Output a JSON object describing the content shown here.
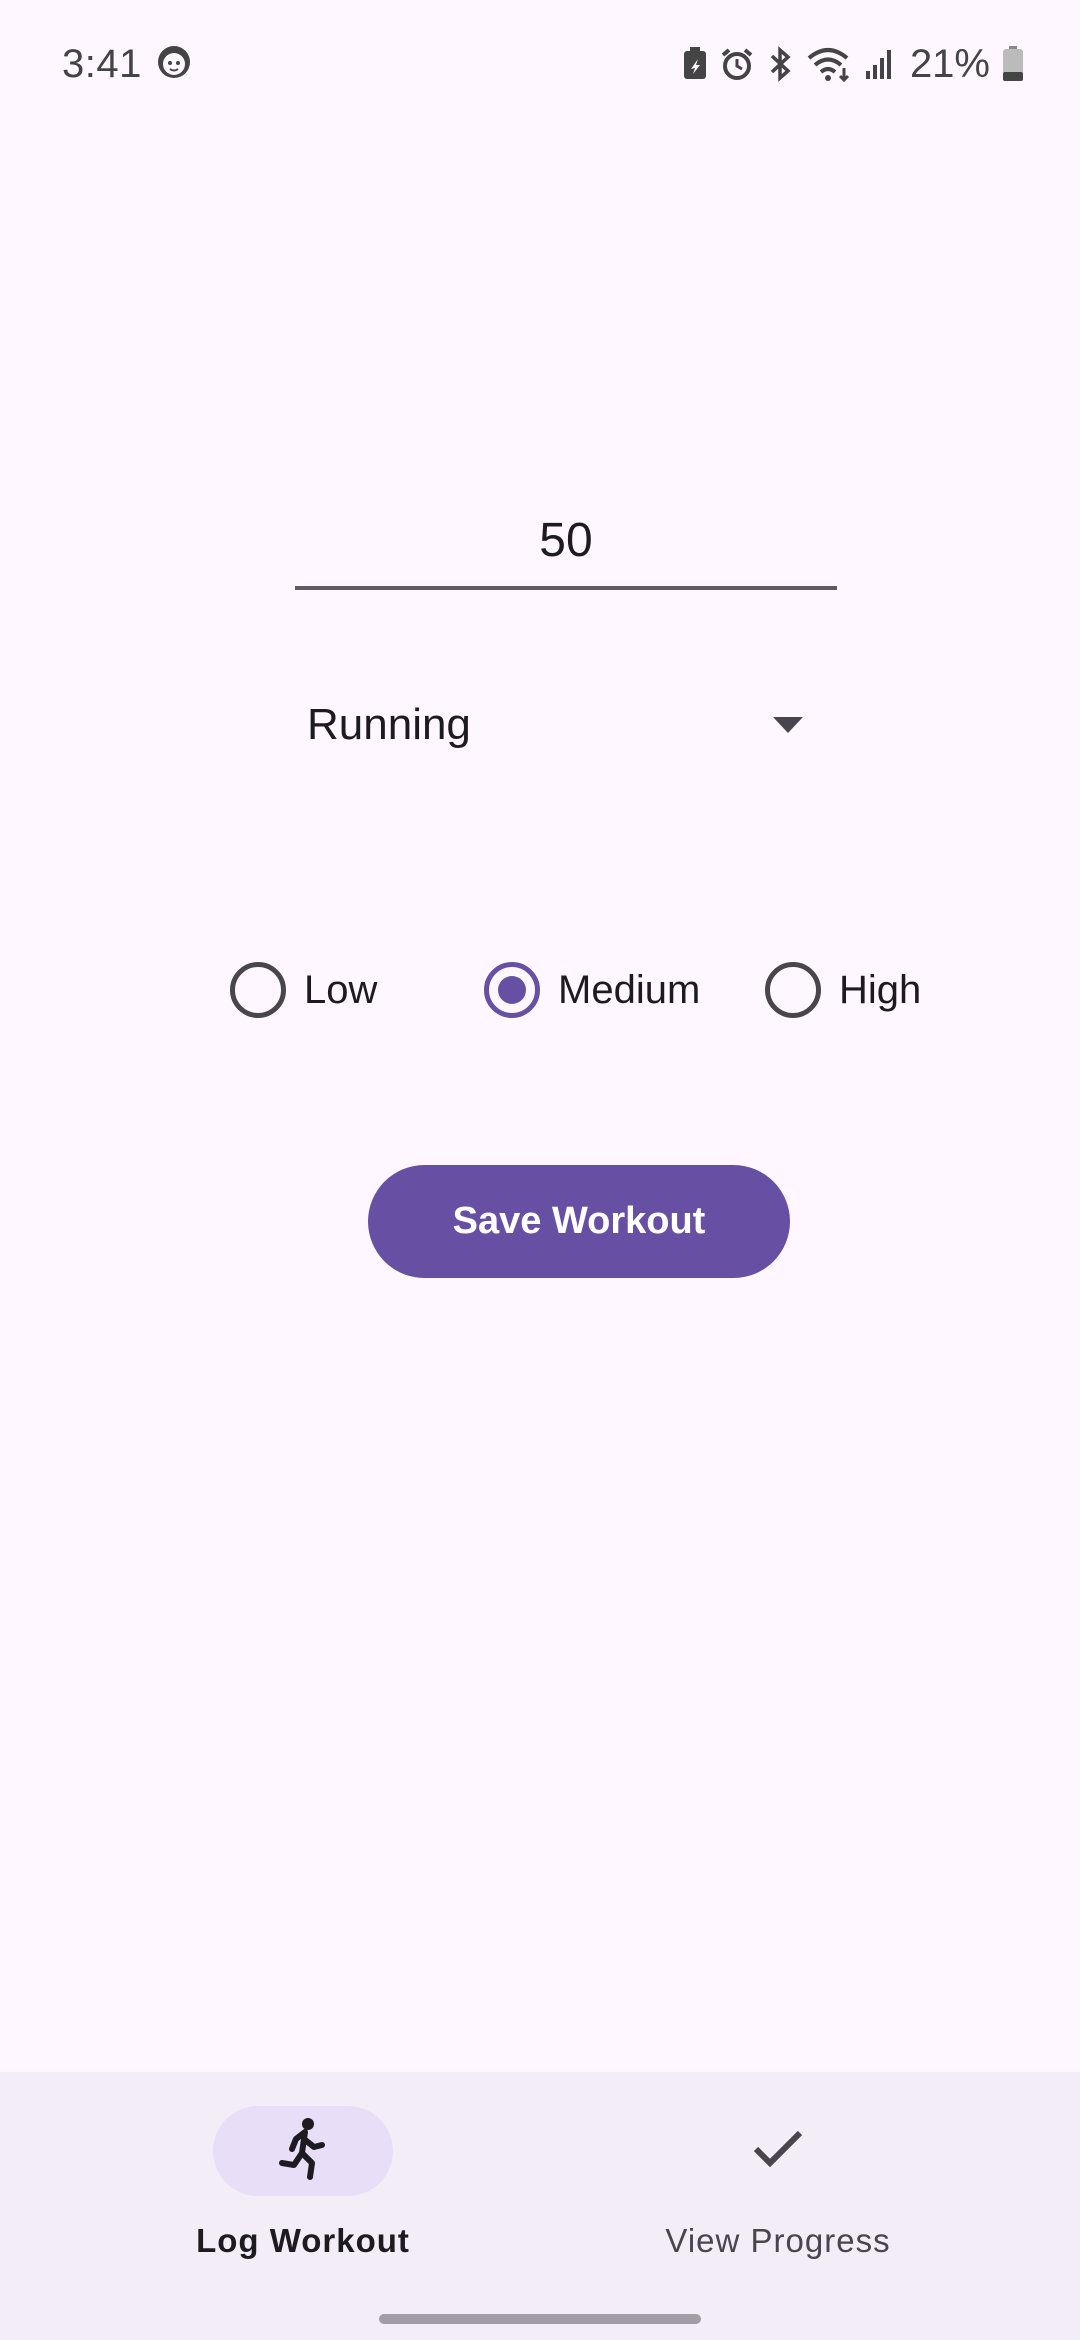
{
  "status_bar": {
    "time": "3:41",
    "battery_percent": "21%",
    "icons": [
      "face-icon",
      "battery-saver-icon",
      "alarm-icon",
      "bluetooth-icon",
      "wifi-icon",
      "signal-icon",
      "battery-icon"
    ]
  },
  "form": {
    "duration_value": "50",
    "activity_selected": "Running",
    "intensity": {
      "options": [
        "Low",
        "Medium",
        "High"
      ],
      "selected": "Medium"
    },
    "save_label": "Save Workout"
  },
  "bottom_nav": {
    "items": [
      {
        "label": "Log Workout",
        "icon": "run-icon",
        "active": true
      },
      {
        "label": "View Progress",
        "icon": "check-icon",
        "active": false
      }
    ]
  },
  "colors": {
    "background": "#fef7ff",
    "primary": "#6750a4",
    "nav_background": "#f3edf7",
    "nav_indicator": "#e8def8"
  }
}
